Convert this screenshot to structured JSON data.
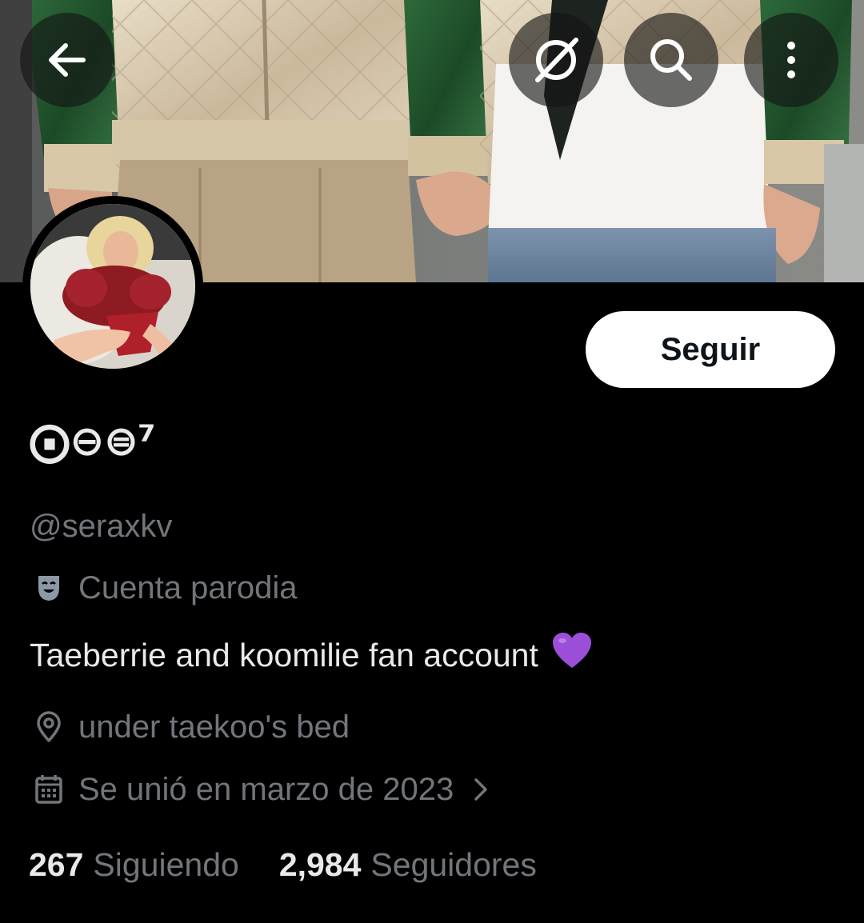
{
  "header": {
    "back_icon": "arrow-left-icon",
    "grok_icon": "slash-circle-icon",
    "search_icon": "search-icon",
    "more_icon": "more-vertical-icon"
  },
  "profile": {
    "display_name": "⨀⊖⊜⁷",
    "handle": "@seraxkv",
    "parody_label": "Cuenta parodia",
    "bio": "Taeberrie and koomilie fan account",
    "bio_emoji": "purple-heart-icon",
    "location": "under taekoo's bed",
    "joined": "Se unió en marzo de 2023",
    "follow_button": "Seguir"
  },
  "stats": {
    "following_count": "267",
    "following_label": "Siguiendo",
    "followers_count": "2,984",
    "followers_label": "Seguidores"
  },
  "colors": {
    "background": "#000000",
    "primary_text": "#e7e9ea",
    "secondary_text": "#71767b",
    "button_bg": "#ffffff",
    "heart": "#9b4fd8"
  }
}
